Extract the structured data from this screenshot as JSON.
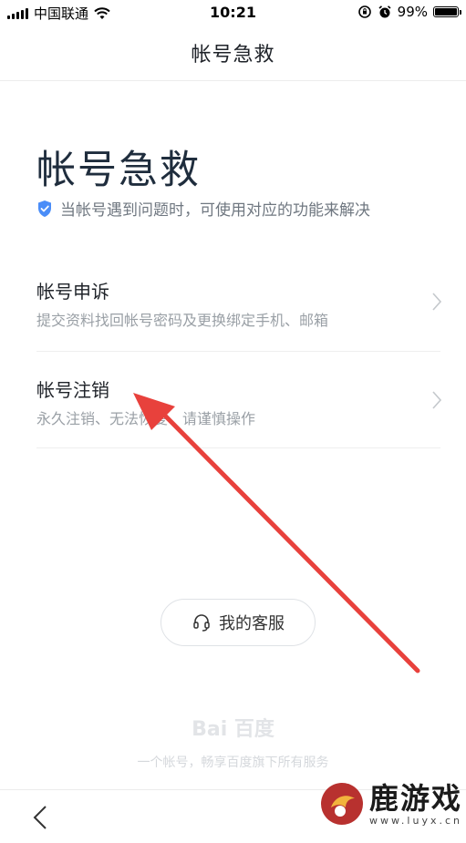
{
  "status_bar": {
    "carrier": "中国联通",
    "time": "10:21",
    "battery_percent": "99%",
    "battery_level": 0.99
  },
  "nav": {
    "title": "帐号急救"
  },
  "main": {
    "heading": "帐号急救",
    "subtitle": "当帐号遇到问题时，可使用对应的功能来解决",
    "items": [
      {
        "title": "帐号申诉",
        "desc": "提交资料找回帐号密码及更换绑定手机、邮箱"
      },
      {
        "title": "帐号注销",
        "desc": "永久注销、无法恢复、请谨慎操作"
      }
    ],
    "service_button": "我的客服"
  },
  "footer": {
    "logo_text": "Bai 百度",
    "slogan": "一个帐号，畅享百度旗下所有服务"
  },
  "watermark": {
    "name": "鹿游戏",
    "url": "www.luyx.cn"
  },
  "colors": {
    "shield": "#4a8df8",
    "arrow": "#e8413c",
    "heading": "#1f2d3d"
  },
  "icons": {
    "shield": "shield-icon",
    "chevron": "chevron-right-icon",
    "headset": "headset-icon",
    "back": "back-arrow-icon"
  }
}
